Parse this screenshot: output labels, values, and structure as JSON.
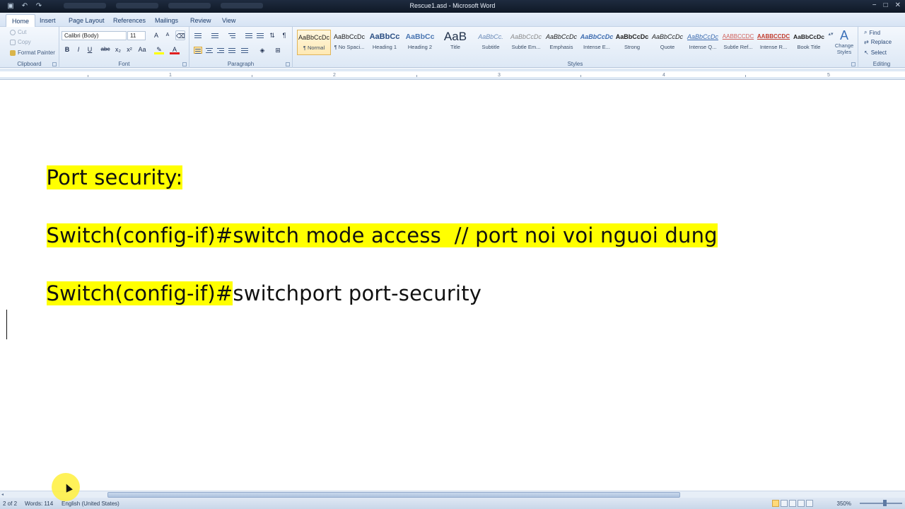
{
  "window": {
    "title": "Rescue1.asd - Microsoft Word",
    "controls": [
      "−",
      "□",
      "✕"
    ]
  },
  "quick_access": [
    "save-icon",
    "undo-icon",
    "redo-icon"
  ],
  "tabs": [
    {
      "label": "Home",
      "active": true
    },
    {
      "label": "Insert"
    },
    {
      "label": "Page Layout"
    },
    {
      "label": "References"
    },
    {
      "label": "Mailings"
    },
    {
      "label": "Review"
    },
    {
      "label": "View"
    }
  ],
  "clipboard": {
    "cut": "Cut",
    "copy": "Copy",
    "format_painter": "Format Painter",
    "label": "Clipboard"
  },
  "font": {
    "name": "Calibri (Body)",
    "size": "11",
    "label": "Font",
    "bold": "B",
    "italic": "I",
    "underline": "U",
    "strike": "abc",
    "sub": "x₂",
    "sup": "x²",
    "case": "Aa",
    "grow": "A",
    "shrink": "A",
    "color": "A"
  },
  "paragraph": {
    "label": "Paragraph",
    "pilcrow": "¶"
  },
  "styles": {
    "label": "Styles",
    "items": [
      {
        "preview": "AaBbCcDc",
        "name": "¶ Normal"
      },
      {
        "preview": "AaBbCcDc",
        "name": "¶ No Spaci..."
      },
      {
        "preview": "AaBbCc",
        "name": "Heading 1"
      },
      {
        "preview": "AaBbCc",
        "name": "Heading 2"
      },
      {
        "preview": "AaB",
        "name": "Title"
      },
      {
        "preview": "AaBbCc.",
        "name": "Subtitle"
      },
      {
        "preview": "AaBbCcDc",
        "name": "Subtle Em..."
      },
      {
        "preview": "AaBbCcDc",
        "name": "Emphasis"
      },
      {
        "preview": "AaBbCcDc",
        "name": "Intense E..."
      },
      {
        "preview": "AaBbCcDc",
        "name": "Strong"
      },
      {
        "preview": "AaBbCcDc",
        "name": "Quote"
      },
      {
        "preview": "AaBbCcDc",
        "name": "Intense Q..."
      },
      {
        "preview": "AABBCCDC",
        "name": "Subtle Ref..."
      },
      {
        "preview": "AABBCCDC",
        "name": "Intense R..."
      },
      {
        "preview": "AaBbCcDc",
        "name": "Book Title"
      }
    ],
    "change_styles": "Change Styles"
  },
  "editing": {
    "label": "Editing",
    "find": "Find",
    "replace": "Replace",
    "select": "Select"
  },
  "ruler": {
    "numbers": [
      "1",
      "2",
      "3",
      "4",
      "5"
    ]
  },
  "document": {
    "line1": "Port security:",
    "line2": "Switch(config-if)#switch mode access  // port noi voi nguoi dung",
    "line3_highlighted": "Switch(config-if)#",
    "line3_rest": "switchport port-security"
  },
  "status": {
    "page": "2 of 2",
    "words": "Words: 114",
    "language": "English (United States)",
    "zoom": "350%"
  }
}
